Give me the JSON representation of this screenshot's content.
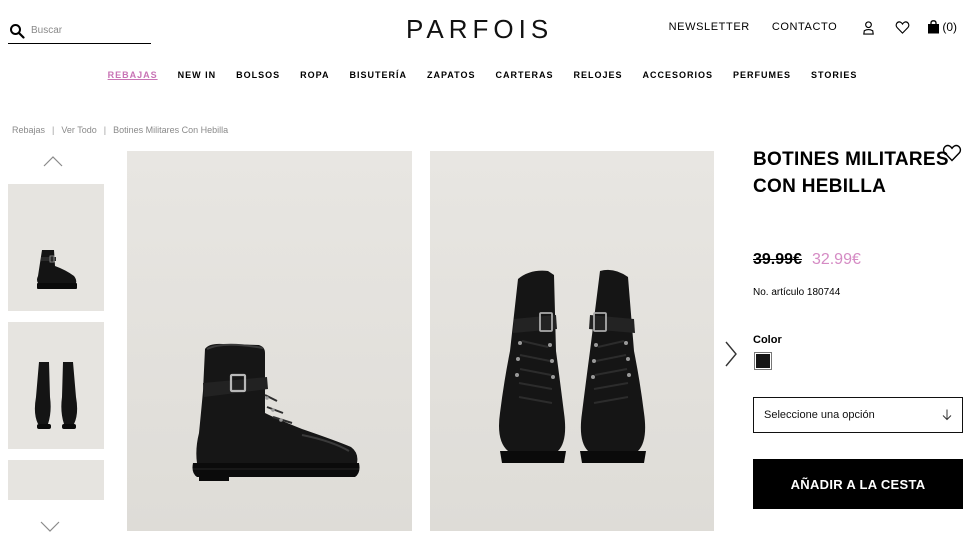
{
  "header": {
    "search_placeholder": "Buscar",
    "logo": "PARFOIS",
    "newsletter": "NEWSLETTER",
    "contact": "CONTACTO",
    "cart_count": "(0)",
    "icons": [
      "search-icon",
      "user-icon",
      "heart-icon",
      "bag-icon"
    ]
  },
  "nav": {
    "items": [
      "REBAJAS",
      "NEW IN",
      "BOLSOS",
      "ROPA",
      "BISUTERÍA",
      "ZAPATOS",
      "CARTERAS",
      "RELOJES",
      "ACCESORIOS",
      "PERFUMES",
      "STORIES"
    ],
    "active": "REBAJAS",
    "active_color": "#c873b5"
  },
  "breadcrumb": {
    "items": [
      "Rebajas",
      "Ver Todo",
      "Botines Militares Con Hebilla"
    ],
    "separator": "|"
  },
  "product": {
    "title": "BOTINES MILITARES CON HEBILLA",
    "old_price": "39.99€",
    "new_price": "32.99€",
    "sku": "No. artículo 180744",
    "color_label": "Color",
    "selected_color": "#151515",
    "size_select": "Seleccione una opción",
    "add_to_cart": "AÑADIR A LA CESTA",
    "sale_price_color": "#d58bc4"
  }
}
